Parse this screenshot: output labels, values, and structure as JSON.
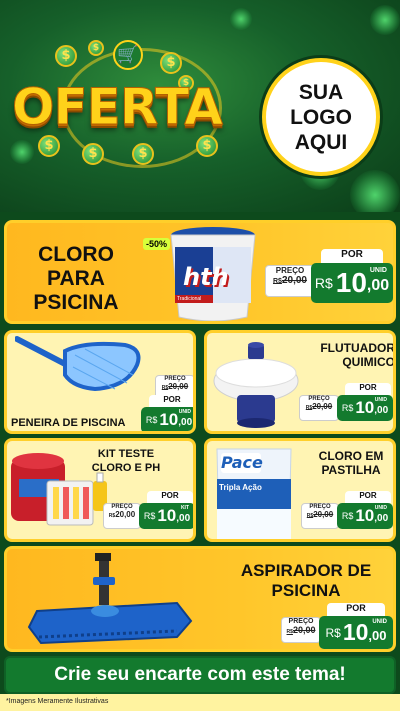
{
  "header": {
    "title": "OFERTA",
    "logo_lines": [
      "SUA",
      "LOGO",
      "AQUI"
    ],
    "coin_symbol": "$",
    "cart_icon": "shopping-cart-icon"
  },
  "products": [
    {
      "name_lines": [
        "CLORO",
        "PARA",
        "PSICINA"
      ],
      "discount": "-50%",
      "old_label": "PREÇO",
      "old_currency": "R$",
      "old_price": "20,00",
      "por_label": "POR",
      "currency": "R$",
      "price_int": "10",
      "price_dec": ",00",
      "unit": "UNID"
    },
    {
      "name_lines": [
        "PENEIRA DE PISCINA"
      ],
      "old_label": "PREÇO",
      "old_currency": "R$",
      "old_price": "20,00",
      "por_label": "POR",
      "currency": "R$",
      "price_int": "10",
      "price_dec": ",00",
      "unit": "UNID"
    },
    {
      "name_lines": [
        "FLUTUADOR",
        "QUIMICO"
      ],
      "old_label": "PREÇO",
      "old_currency": "R$",
      "old_price": "20,00",
      "por_label": "POR",
      "currency": "R$",
      "price_int": "10",
      "price_dec": ",00",
      "unit": "UNID"
    },
    {
      "name_lines": [
        "KIT TESTE",
        "CLORO E PH"
      ],
      "old_label": "PREÇO",
      "old_currency": "R$",
      "old_price": "20,00",
      "por_label": "POR",
      "currency": "R$",
      "price_int": "10",
      "price_dec": ",00",
      "unit": "KIT"
    },
    {
      "name_lines": [
        "CLORO EM",
        "PASTILHA"
      ],
      "old_label": "PREÇO",
      "old_currency": "R$",
      "old_price": "20,00",
      "por_label": "POR",
      "currency": "R$",
      "price_int": "10",
      "price_dec": ",00",
      "unit": "UNID"
    },
    {
      "name_lines": [
        "ASPIRADOR DE",
        "PSICINA"
      ],
      "old_label": "PREÇO",
      "old_currency": "R$",
      "old_price": "20,00",
      "por_label": "POR",
      "currency": "R$",
      "price_int": "10",
      "price_dec": ",00",
      "unit": "UNID"
    }
  ],
  "product_images": {
    "bucket_brand": "hth",
    "bucket_sub": "Tradicional",
    "pack_brand": "Pace",
    "pack_sub": "Tripla Ação"
  },
  "footer": {
    "cta": "Crie seu encarte com este tema!",
    "disclaimer": "*Imagens Meramente Ilustrativas"
  },
  "colors": {
    "green": "#137a2e",
    "yellow": "#ffc62a",
    "gold": "#ffd21a"
  }
}
